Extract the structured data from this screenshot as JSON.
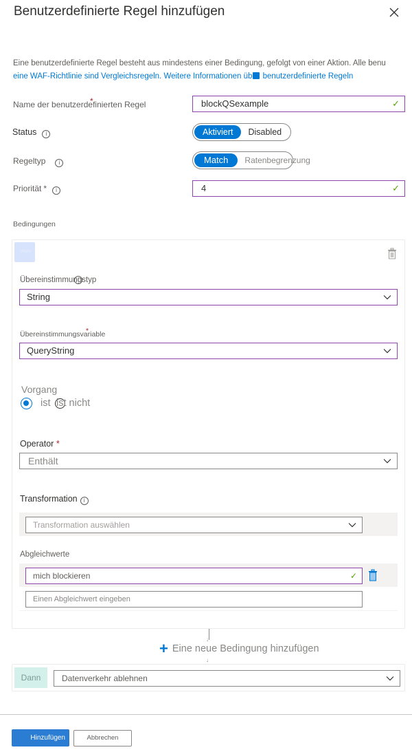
{
  "panel": {
    "title": "Benutzerdefinierte Regel hinzufügen",
    "close_icon": "close-icon"
  },
  "description": {
    "line1": "Eine benutzerdefinierte Regel besteht aus mindestens einer Bedingung, gefolgt von einer Aktion. Alle benu",
    "line2_prefix": "eine WAF-Richtlinie sind Vergleichsregeln. Weitere Informationen üb",
    "line2_link": "benutzerdefinierte Regeln"
  },
  "form": {
    "rule_name": {
      "label": "Name der benutzerdefinierten Regel",
      "required_mark": "*",
      "value": "blockQSexample",
      "valid": true
    },
    "status": {
      "label": "Status",
      "options": [
        "Aktiviert",
        "Disabled"
      ],
      "selected": "Aktiviert"
    },
    "rule_type": {
      "label": "Regeltyp",
      "options": [
        "Match",
        "Ratenbegrenzung"
      ],
      "selected": "Match"
    },
    "priority": {
      "label": "Priorität",
      "required_mark": "*",
      "value": "4",
      "valid": true
    }
  },
  "conditions": {
    "section_label": "Bedingungen",
    "chip_label": "Wenn",
    "match_type": {
      "label": "Übereinstimmungstyp",
      "value": "String"
    },
    "match_variable": {
      "label": "Übereinstimmungsvariable",
      "required_mark": "*",
      "value": "QueryString"
    },
    "operation": {
      "label": "Vorgang",
      "options": [
        "ist",
        "ist nicht"
      ],
      "selected": "ist"
    },
    "operator": {
      "label": "Operator",
      "required_mark": "*",
      "value": "Enthält"
    },
    "transformation": {
      "label": "Transformation",
      "placeholder": "Transformation auswählen"
    },
    "match_values": {
      "label": "Abgleichwerte",
      "values": [
        "mich blockieren"
      ],
      "placeholder": "Einen Abgleichwert eingeben"
    }
  },
  "add_condition_label": "Eine neue Bedingung hinzufügen",
  "then": {
    "chip_label": "Dann",
    "action": "Datenverkehr ablehnen"
  },
  "footer": {
    "add_button": "Hinzufügen",
    "cancel_button": "Abbrechen"
  },
  "colors": {
    "accent": "#0078d4",
    "focus_border": "#8e44ad",
    "valid_check": "#57a300",
    "required": "#a4262c"
  }
}
